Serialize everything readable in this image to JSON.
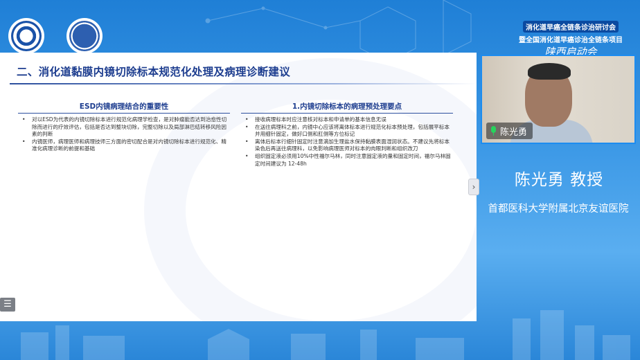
{
  "event": {
    "line1": "消化道早癌全链条诊治研讨会",
    "line2": "暨全国消化道早癌诊治全链条项目",
    "line3": "陕西启动会"
  },
  "slide": {
    "title": "二、消化道黏膜内镜切除标本规范化处理及病理诊断建议",
    "left": {
      "heading": "ESD内镜病理结合的重要性",
      "items": [
        "对以ESD为代表的内镜切除标本进行规范化病理学检查，是对肿瘤能否达到治愈性切除而进行的疗效评估，包括是否达到整块切除，完整切除以及局部淋巴结转移风险因素的判断",
        "内镜医师，病理医师和病理技师三方面的密切配合是对内镜切除标本进行规范化、精准化病理诊断的前提和基础"
      ]
    },
    "right": {
      "heading": "1.内镜切除标本的病理预处理要点",
      "items": [
        "接收病理标本时应注意核对标本和申请单的基本信息无误",
        "在送往病理科之前，内镜中心应该将离体标本进行规范化标本预处理，包括展平标本并用细针固定，做好口侧和肛侧等方位标记",
        "离体后标本行细针固定时注意滴加生理盐水保持黏膜表面湿润状态。不建议先将标本染色后再送往病理科，以免影响病理医师对标本的肉眼判断和组织改刀",
        "组织固定液必须用10%中性福尔马林，同时注意固定液的量和固定时间，福尔马林固定时间建议为 12-48h"
      ]
    }
  },
  "controls": {
    "next_arrow": "›",
    "menu_icon": "☰"
  },
  "video": {
    "participant_name": "陈光勇"
  },
  "speaker": {
    "name": "陈光勇  教授",
    "hospital": "首都医科大学附属北京友谊医院"
  },
  "colors": {
    "background_blue": "#3b98e6",
    "title_blue": "#1d3d8f",
    "mic_green": "#27d35c",
    "video_border": "#1c8cf0"
  }
}
